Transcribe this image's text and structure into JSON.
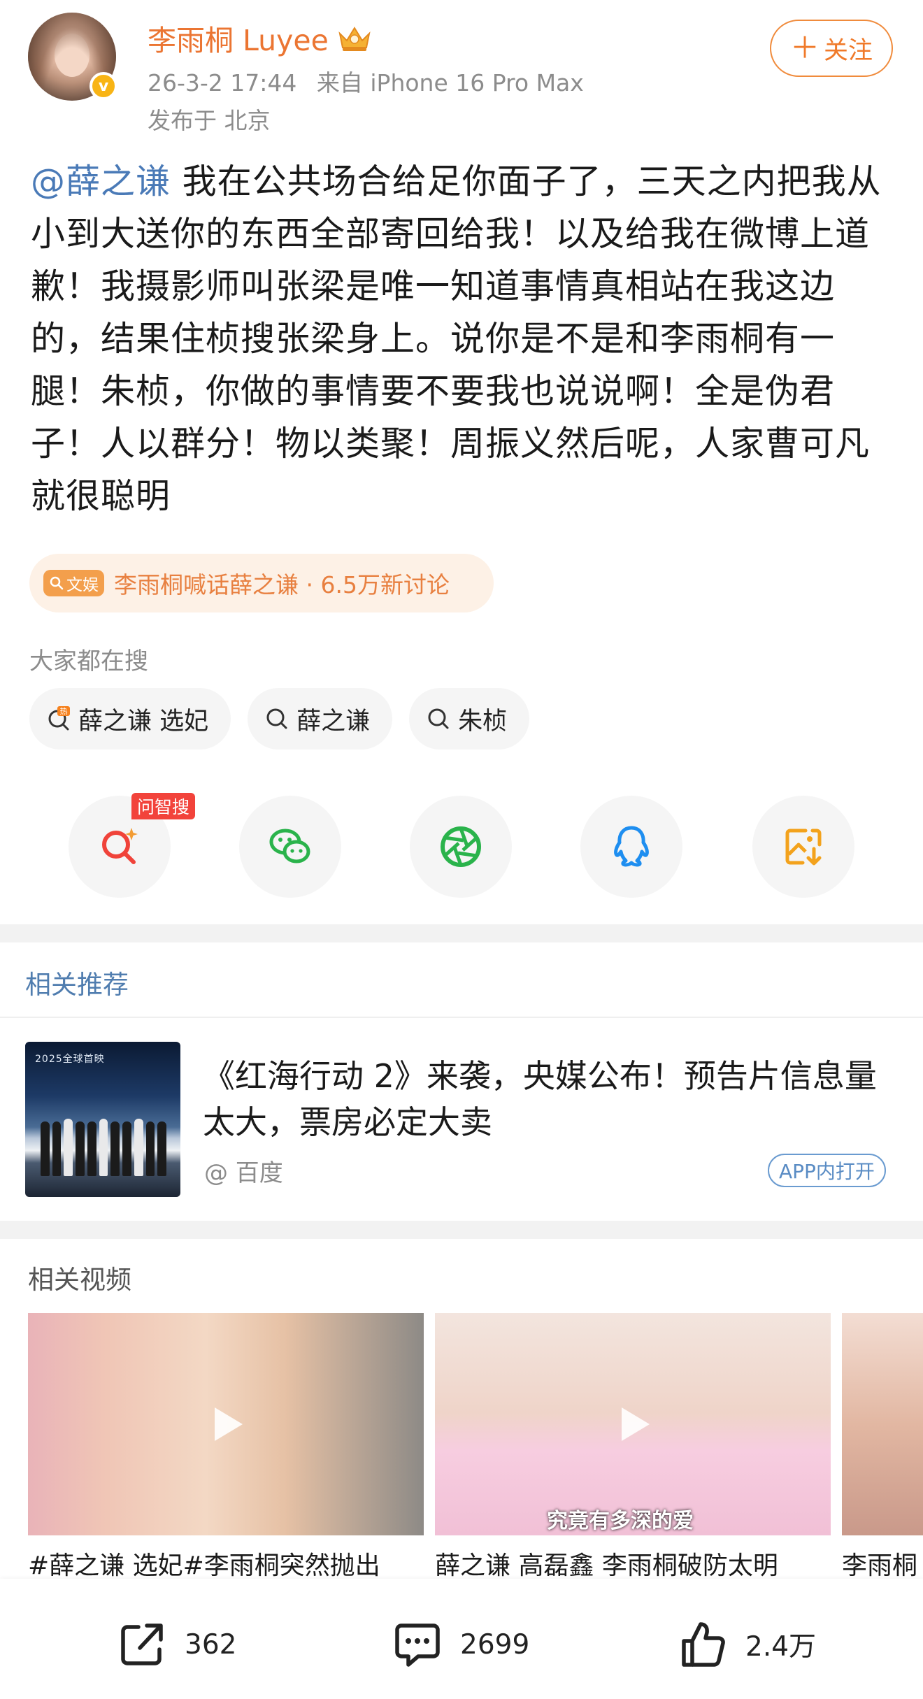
{
  "post": {
    "author": {
      "name": "李雨桐 Luyee",
      "verified_mark": "v"
    },
    "meta": {
      "time": "26-3-2 17:44",
      "source": "来自 iPhone 16 Pro Max",
      "location": "发布于 北京"
    },
    "follow_label": "关注",
    "text": {
      "mention": "@薛之谦",
      "body": " 我在公共场合给足你面子了，三天之内把我从小到大送你的东西全部寄回给我！以及给我在微博上道歉！我摄影师叫张梁是唯一知道事情真相站在我这边的，结果住桢搜张梁身上。说你是不是和李雨桐有一腿！朱桢，你做的事情要不要我也说说啊！全是伪君子！人以群分！物以类聚！周振义然后呢，人家曹可凡就很聪明"
    },
    "topic": {
      "tag": "文娱",
      "text": "李雨桐喊话薛之谦 · 6.5万新讨论"
    }
  },
  "search": {
    "label": "大家都在搜",
    "chips": [
      {
        "label": "薛之谦 选妃",
        "icon": "hot-search-icon"
      },
      {
        "label": "薛之谦",
        "icon": "search-icon"
      },
      {
        "label": "朱桢",
        "icon": "search-icon"
      }
    ]
  },
  "share": {
    "ai_badge": "问智搜",
    "buttons": [
      "ai-search-icon",
      "wechat-icon",
      "moments-icon",
      "qq-icon",
      "save-image-icon"
    ]
  },
  "recommend": {
    "section_title": "相关推荐",
    "item": {
      "title": "《红海行动 2》来袭，央媒公布！预告片信息量太大，票房必定大卖",
      "source": "@ 百度",
      "open_label": "APP内打开",
      "thumb_caption": "2025全球首映"
    }
  },
  "videos": {
    "section_title": "相关视频",
    "items": [
      {
        "caption": "#薛之谦 选妃#李雨桐突然抛出"
      },
      {
        "caption": "薛之谦 高磊鑫 李雨桐破防太明",
        "subtitle": "究竟有多深的爱"
      },
      {
        "caption": "李雨桐"
      }
    ]
  },
  "actions": {
    "repost": "362",
    "comment": "2699",
    "like": "2.4万"
  },
  "colors": {
    "accent_orange": "#eb7532",
    "mention_blue": "#4a7ab7",
    "verify_yellow": "#f8b415",
    "badge_red": "#f2433b"
  }
}
